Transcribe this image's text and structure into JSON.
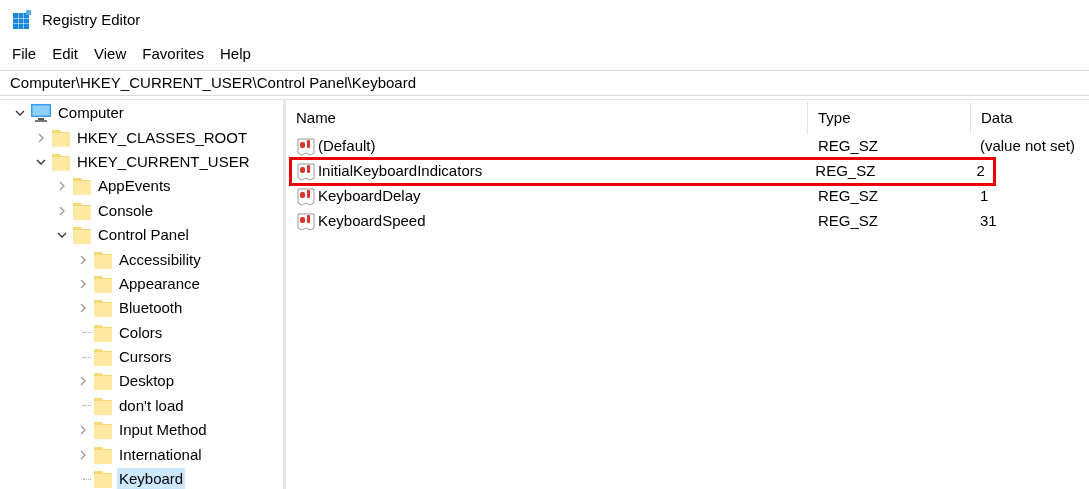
{
  "window": {
    "title": "Registry Editor"
  },
  "menu": [
    "File",
    "Edit",
    "View",
    "Favorites",
    "Help"
  ],
  "address": "Computer\\HKEY_CURRENT_USER\\Control Panel\\Keyboard",
  "tree": [
    {
      "label": "Computer",
      "kind": "computer",
      "expanded": true,
      "selected": false,
      "children": [
        {
          "label": "HKEY_CLASSES_ROOT",
          "kind": "folder",
          "expanded": false,
          "selected": false
        },
        {
          "label": "HKEY_CURRENT_USER",
          "kind": "folder",
          "expanded": true,
          "selected": false,
          "children": [
            {
              "label": "AppEvents",
              "kind": "folder",
              "expanded": false,
              "selected": false
            },
            {
              "label": "Console",
              "kind": "folder",
              "expanded": false,
              "selected": false
            },
            {
              "label": "Control Panel",
              "kind": "folder",
              "expanded": true,
              "selected": false,
              "children": [
                {
                  "label": "Accessibility",
                  "kind": "folder",
                  "expanded": false,
                  "selected": false
                },
                {
                  "label": "Appearance",
                  "kind": "folder",
                  "expanded": false,
                  "selected": false
                },
                {
                  "label": "Bluetooth",
                  "kind": "folder",
                  "expanded": false,
                  "selected": false
                },
                {
                  "label": "Colors",
                  "kind": "folder",
                  "selected": false
                },
                {
                  "label": "Cursors",
                  "kind": "folder",
                  "selected": false
                },
                {
                  "label": "Desktop",
                  "kind": "folder",
                  "expanded": false,
                  "selected": false
                },
                {
                  "label": "don't load",
                  "kind": "folder",
                  "selected": false
                },
                {
                  "label": "Input Method",
                  "kind": "folder",
                  "expanded": false,
                  "selected": false
                },
                {
                  "label": "International",
                  "kind": "folder",
                  "expanded": false,
                  "selected": false
                },
                {
                  "label": "Keyboard",
                  "kind": "folder",
                  "selected": true
                }
              ]
            }
          ]
        }
      ]
    }
  ],
  "table": {
    "columns": [
      "Name",
      "Type",
      "Data"
    ],
    "rows": [
      {
        "name": "(Default)",
        "type": "REG_SZ",
        "data": "(value not set)",
        "highlighted": false
      },
      {
        "name": "InitialKeyboardIndicators",
        "type": "REG_SZ",
        "data": "2",
        "highlighted": true
      },
      {
        "name": "KeyboardDelay",
        "type": "REG_SZ",
        "data": "1",
        "highlighted": false
      },
      {
        "name": "KeyboardSpeed",
        "type": "REG_SZ",
        "data": "31",
        "highlighted": false
      }
    ]
  }
}
